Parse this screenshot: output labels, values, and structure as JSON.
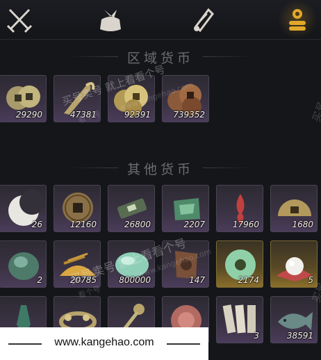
{
  "tabs": [
    {
      "icon": "crossed-swords-icon"
    },
    {
      "icon": "cloth-bundle-icon"
    },
    {
      "icon": "scroll-icon"
    },
    {
      "icon": "coin-stack-icon",
      "active": true
    }
  ],
  "sections": {
    "regional_title": "区域货币",
    "other_title": "其他货币"
  },
  "regional_items": [
    {
      "icon": "copper-coins-icon",
      "count": "29290"
    },
    {
      "icon": "bronze-hook-icon",
      "count": "47381"
    },
    {
      "icon": "gold-coins-icon",
      "count": "92391"
    },
    {
      "icon": "copper-coin-pile-icon",
      "count": "739352"
    }
  ],
  "other_items": [
    {
      "icon": "crescent-moon-icon",
      "count": "26"
    },
    {
      "icon": "square-hole-coin-icon",
      "count": "12160"
    },
    {
      "icon": "jade-token-icon",
      "count": "26800"
    },
    {
      "icon": "jade-cloth-icon",
      "count": "2207"
    },
    {
      "icon": "red-flame-icon",
      "count": "17960"
    },
    {
      "icon": "half-coin-icon",
      "count": "1680"
    },
    {
      "icon": "jade-stone-icon",
      "count": "2"
    },
    {
      "icon": "grain-pile-icon",
      "count": "20785"
    },
    {
      "icon": "jade-pebble-icon",
      "count": "800000"
    },
    {
      "icon": "carved-tablet-icon",
      "count": "147"
    },
    {
      "icon": "jade-ring-icon",
      "count": "2174"
    },
    {
      "icon": "pearl-icon",
      "count": "5"
    },
    {
      "icon": "green-pendant-icon",
      "count": ""
    },
    {
      "icon": "coin-string-icon",
      "count": ""
    },
    {
      "icon": "coin-sword-icon",
      "count": ""
    },
    {
      "icon": "red-jade-icon",
      "count": ""
    },
    {
      "icon": "paper-slips-icon",
      "count": "3"
    },
    {
      "icon": "jade-fish-icon",
      "count": "38591"
    }
  ],
  "watermarks": {
    "line1": "买号卖号 就上看看个号",
    "line2": "www.kangehao.com",
    "line3": "看个号",
    "badge": "买号"
  },
  "footer": {
    "text": "www.kangehao.com"
  }
}
